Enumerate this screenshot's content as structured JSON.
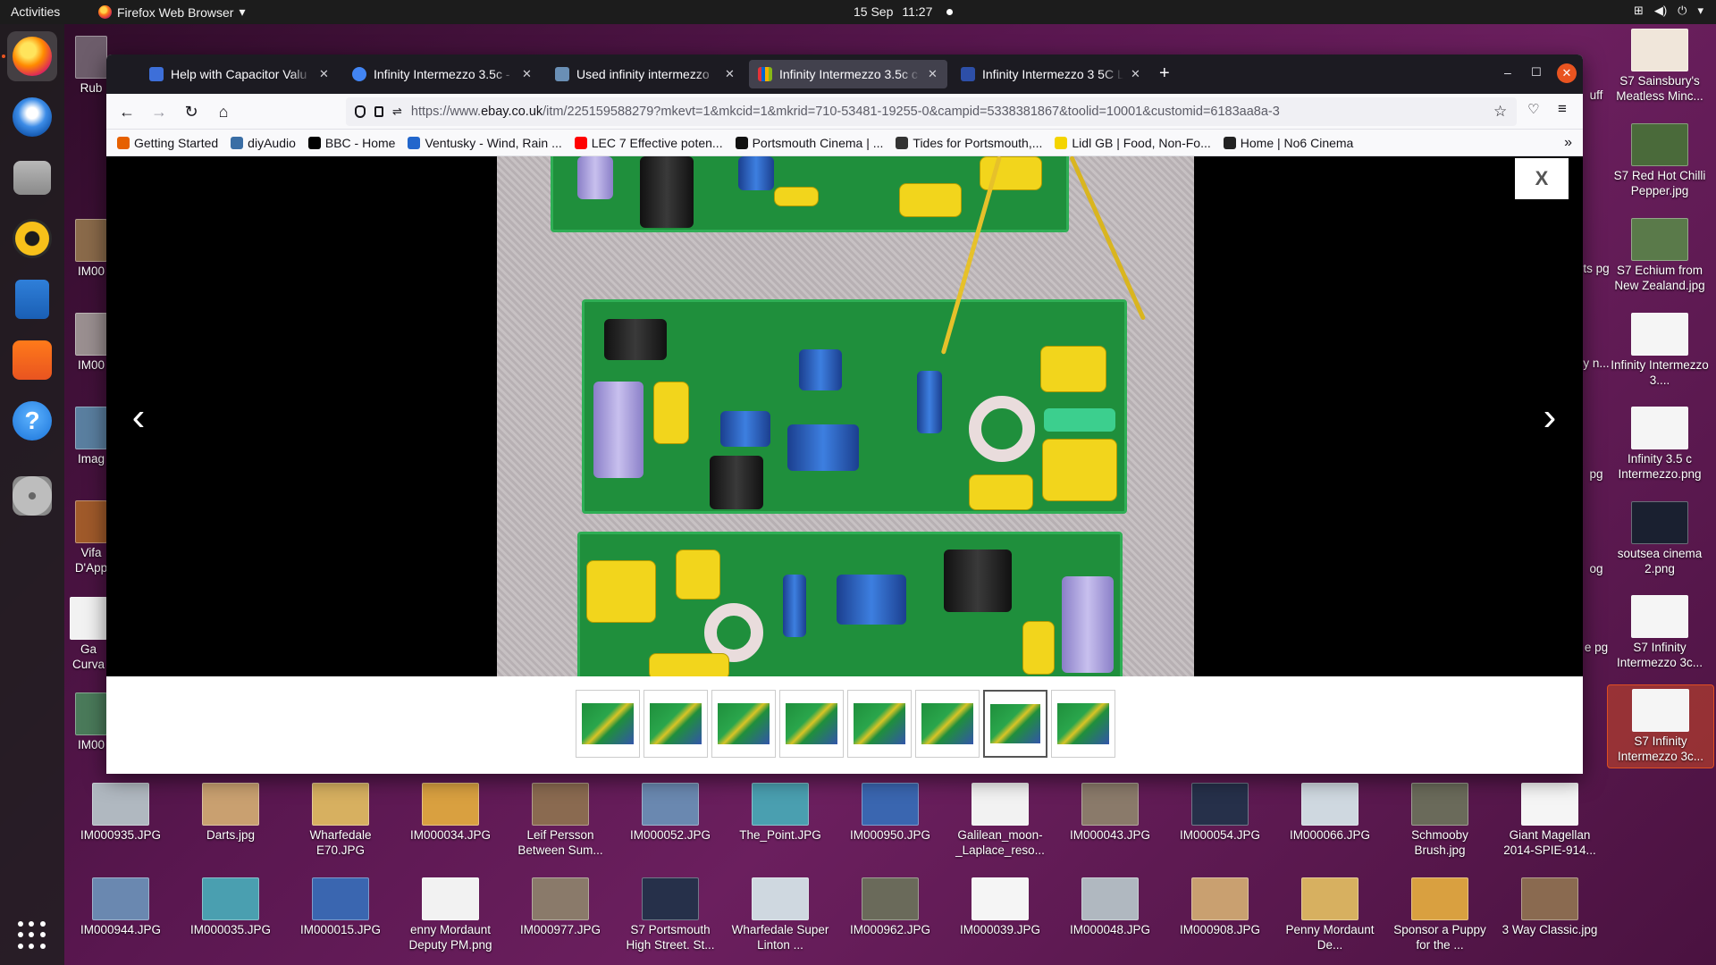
{
  "topbar": {
    "activities": "Activities",
    "app_name": "Firefox Web Browser",
    "date": "15 Sep",
    "time": "11:27"
  },
  "dock": {
    "items": [
      "Firefox",
      "Thunderbird",
      "Files",
      "Rhythmbox",
      "LibreOffice Writer",
      "Ubuntu Software",
      "Help",
      "Disc"
    ]
  },
  "desktop": {
    "left_partial": [
      "Rub",
      "IM00",
      "IM00",
      "Imag",
      "Vifa D'App",
      "Ga Curva",
      "IM00"
    ],
    "right_column": [
      "S7 Sainsbury's Meatless Minc...",
      "S7 Red Hot Chilli Pepper.jpg",
      "S7 Echium from New Zealand.jpg",
      "Infinity Intermezzo 3....",
      "Infinity 3.5 c Intermezzo.png",
      "soutsea cinema 2.png",
      "S7 Infinity Intermezzo 3c...",
      "S7 Infinity Intermezzo 3c..."
    ],
    "right_partial": [
      "uff",
      "ts pg",
      "y n...",
      "pg",
      "og",
      "e pg"
    ],
    "row1": [
      "IM000935.JPG",
      "Darts.jpg",
      "Wharfedale E70.JPG",
      "IM000034.JPG",
      "Leif Persson Between Sum...",
      "IM000052.JPG",
      "The_Point.JPG",
      "IM000950.JPG",
      "Galilean_moon-_Laplace_reso...",
      "IM000043.JPG",
      "IM000054.JPG",
      "IM000066.JPG",
      "Schmooby Brush.jpg",
      "Giant Magellan 2014-SPIE-914..."
    ],
    "row2": [
      "IM000944.JPG",
      "IM000035.JPG",
      "IM000015.JPG",
      "enny Mordaunt Deputy PM.png",
      "IM000977.JPG",
      "S7 Portsmouth High Street. St...",
      "Wharfedale Super Linton ...",
      "IM000962.JPG",
      "IM000039.JPG",
      "IM000048.JPG",
      "IM000908.JPG",
      "Penny Mordaunt De...",
      "Sponsor a Puppy for the ...",
      "3 Way Classic.jpg"
    ]
  },
  "browser": {
    "tabs": [
      {
        "title": "Help with Capacitor Valu",
        "favicon_color": "#3d6fd9"
      },
      {
        "title": "Infinity Intermezzo 3.5c -",
        "favicon_color": "#4285f4"
      },
      {
        "title": "Used infinity intermezzo",
        "favicon_color": "#6a8fb5"
      },
      {
        "title": "Infinity Intermezzo 3.5c c",
        "favicon_color": "#e53238"
      },
      {
        "title": "Infinity Intermezzo 3 5C L",
        "favicon_color": "#2d4fa8"
      }
    ],
    "url_prefix": "https://www.",
    "url_domain": "ebay.co.uk",
    "url_rest": "/itm/225159588279?mkevt=1&mkcid=1&mkrid=710-53481-19255-0&campid=5338381867&toolid=10001&customid=6183aa8a-3",
    "bookmarks": [
      {
        "label": "Getting Started",
        "color": "#e66000"
      },
      {
        "label": "diyAudio",
        "color": "#3a6ea5"
      },
      {
        "label": "BBC - Home",
        "color": "#000000"
      },
      {
        "label": "Ventusky - Wind, Rain ...",
        "color": "#2266cc"
      },
      {
        "label": "LEC 7 Effective poten...",
        "color": "#ff0000"
      },
      {
        "label": "Portsmouth Cinema | ...",
        "color": "#111111"
      },
      {
        "label": "Tides for Portsmouth,...",
        "color": "#333333"
      },
      {
        "label": "Lidl GB | Food, Non-Fo...",
        "color": "#f4d400"
      },
      {
        "label": "Home | No6 Cinema",
        "color": "#222222"
      }
    ]
  },
  "viewer": {
    "close_label": "X",
    "prev_label": "‹",
    "next_label": "›",
    "thumbnail_count": 8,
    "selected_thumbnail": 7
  }
}
